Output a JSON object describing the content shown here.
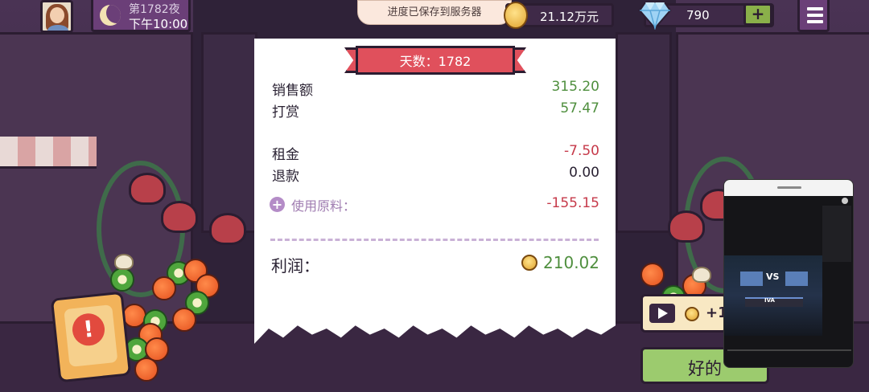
{
  "hud": {
    "day_label": "第1782夜",
    "time_label": "下午10:00",
    "save_toast": "进度已保存到服务器",
    "money": "21.12万元",
    "gems": "790",
    "plus": "+"
  },
  "receipt": {
    "ribbon": "天数：1782",
    "rows": [
      {
        "label": "销售额",
        "value": "315.20"
      },
      {
        "label": "打赏",
        "value": "57.47"
      },
      {
        "label": "租金",
        "value": "-7.50"
      },
      {
        "label": "退款",
        "value": "0.00"
      }
    ],
    "ingredients_label": "使用原料：",
    "ingredients_value": "-155.15",
    "profit_label": "利润：",
    "profit_value": "210.02"
  },
  "actions": {
    "ad_reward": "+1",
    "ok_label": "好的"
  },
  "video": {
    "vs": "VS",
    "desk": "IVA"
  },
  "colors": {
    "positive": "#4f8f3e",
    "negative": "#c63a4a",
    "ribbon": "#e0505c",
    "ok_button": "#9ccb6e"
  },
  "icons": [
    "avatar",
    "moon-icon",
    "coin-icon",
    "diamond-icon",
    "plus-icon",
    "menu-icon",
    "add-circle-icon",
    "alert-icon",
    "play-video-icon"
  ]
}
